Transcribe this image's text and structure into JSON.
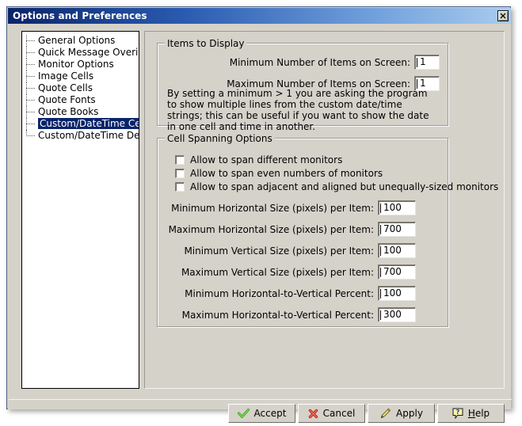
{
  "window": {
    "title": "Options and Preferences",
    "close_icon": "close-x-icon"
  },
  "sidebar": {
    "items": [
      {
        "label": "General Options",
        "selected": false
      },
      {
        "label": "Quick Message Overide",
        "selected": false
      },
      {
        "label": "Monitor Options",
        "selected": false
      },
      {
        "label": "Image Cells",
        "selected": false
      },
      {
        "label": "Quote Cells",
        "selected": false
      },
      {
        "label": "Quote Fonts",
        "selected": false
      },
      {
        "label": "Quote Books",
        "selected": false
      },
      {
        "label": "Custom/DateTime Cells",
        "selected": true
      },
      {
        "label": "Custom/DateTime Details",
        "selected": false
      }
    ]
  },
  "items_to_display": {
    "title": "Items to Display",
    "min_label": "Minimum Number of Items on Screen:",
    "min_value": "1",
    "max_label": "Maximum Number of Items on Screen:",
    "max_value": "1",
    "description": "By setting a minimum > 1 you are asking the program to show multiple lines from the custom date/time strings; this can be useful if you want to show the date in one cell and time in another."
  },
  "cell_spanning": {
    "title": "Cell Spanning Options",
    "checkboxes": [
      {
        "label": "Allow to span different monitors",
        "checked": false
      },
      {
        "label": "Allow to span even numbers of monitors",
        "checked": false
      },
      {
        "label": "Allow to span adjacent and aligned but unequally-sized monitors",
        "checked": false
      }
    ],
    "fields": [
      {
        "label": "Minimum Horizontal Size (pixels) per Item:",
        "value": "100"
      },
      {
        "label": "Maximum Horizontal Size (pixels) per Item:",
        "value": "700"
      },
      {
        "label": "Minimum Vertical Size (pixels) per Item:",
        "value": "100"
      },
      {
        "label": "Maximum Vertical Size (pixels) per Item:",
        "value": "700"
      },
      {
        "label": "Minimum Horizontal-to-Vertical  Percent:",
        "value": "100"
      },
      {
        "label": "Maximum Horizontal-to-Vertical  Percent:",
        "value": "300"
      }
    ]
  },
  "buttons": {
    "accept": {
      "label": "Accept",
      "icon": "green-check-icon"
    },
    "cancel": {
      "label": "Cancel",
      "icon": "red-x-icon"
    },
    "apply": {
      "label": "Apply",
      "icon": "yellow-pencil-icon"
    },
    "help": {
      "label": "Help",
      "icon": "blue-question-balloon-icon",
      "accel": "H"
    }
  },
  "colors": {
    "title_bar_start": "#0a246a",
    "title_bar_end": "#aaccef",
    "dialog_face": "#d5d2ca",
    "selection": "#0a246a",
    "accept_green": "#55bb33",
    "cancel_red": "#d94a3d",
    "apply_yellow": "#f2d24a",
    "help_blue": "#2255cc"
  }
}
